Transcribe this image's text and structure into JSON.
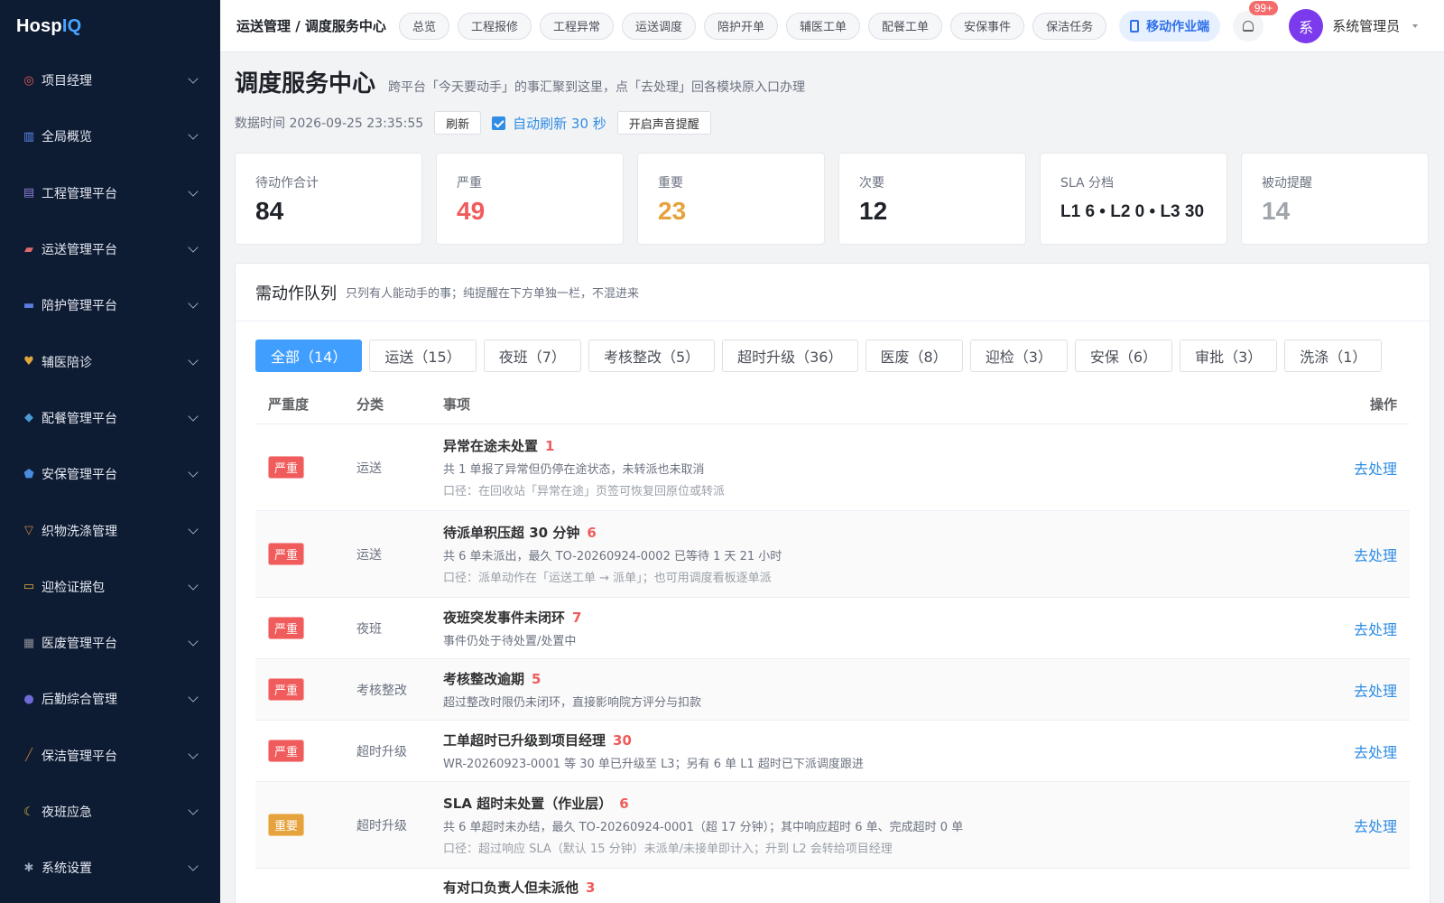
{
  "logo": {
    "part1": "Hosp",
    "part2": "IQ"
  },
  "sidebar": {
    "items": [
      {
        "label": "项目经理",
        "icon": "target-icon",
        "color": "#e85d5d"
      },
      {
        "label": "全局概览",
        "icon": "chart-icon",
        "color": "#5b8def"
      },
      {
        "label": "工程管理平台",
        "icon": "building-icon",
        "color": "#8a7fd6"
      },
      {
        "label": "运送管理平台",
        "icon": "truck-icon",
        "color": "#e06b6b"
      },
      {
        "label": "陪护管理平台",
        "icon": "bed-icon",
        "color": "#5a7de0"
      },
      {
        "label": "辅医陪诊",
        "icon": "heart-icon",
        "color": "#e0a83a"
      },
      {
        "label": "配餐管理平台",
        "icon": "meal-icon",
        "color": "#4a9bd4"
      },
      {
        "label": "安保管理平台",
        "icon": "shield-icon",
        "color": "#4a8ce0"
      },
      {
        "label": "织物洗涤管理",
        "icon": "basket-icon",
        "color": "#c98a3a"
      },
      {
        "label": "迎检证据包",
        "icon": "folder-icon",
        "color": "#e8b23a"
      },
      {
        "label": "医废管理平台",
        "icon": "trash-icon",
        "color": "#8d8f96"
      },
      {
        "label": "后勤综合管理",
        "icon": "people-icon",
        "color": "#6f6ad6"
      },
      {
        "label": "保洁管理平台",
        "icon": "broom-icon",
        "color": "#b0743a"
      },
      {
        "label": "夜班应急",
        "icon": "moon-icon",
        "color": "#e8c43a"
      },
      {
        "label": "系统设置",
        "icon": "gear-icon",
        "color": "#9aa6bb"
      }
    ]
  },
  "header": {
    "breadcrumb": "运送管理 / 调度服务中心",
    "tabs": [
      "总览",
      "工程报修",
      "工程异常",
      "运送调度",
      "陪护开单",
      "辅医工单",
      "配餐工单",
      "安保事件",
      "保洁任务"
    ],
    "mobile_label": "移动作业端",
    "notif_count": "99+",
    "avatar_text": "系",
    "username": "系统管理员"
  },
  "page": {
    "title": "调度服务中心",
    "subtitle": "跨平台「今天要动手」的事汇聚到这里，点「去处理」回各模块原入口办理",
    "data_time": "数据时间 2026-09-25 23:35:55",
    "refresh_label": "刷新",
    "auto_refresh_label": "自动刷新 30 秒",
    "sound_label": "开启声音提醒"
  },
  "stats": [
    {
      "label": "待动作合计",
      "value": "84",
      "color": "#1f2329"
    },
    {
      "label": "严重",
      "value": "49",
      "color": "#f05b5b"
    },
    {
      "label": "重要",
      "value": "23",
      "color": "#e6a23c"
    },
    {
      "label": "次要",
      "value": "12",
      "color": "#1f2329"
    },
    {
      "label": "SLA 分档",
      "value": "L1 6 • L2 0 • L3 30",
      "color": "#1f2329"
    },
    {
      "label": "被动提醒",
      "value": "14",
      "color": "#a0a4ab"
    }
  ],
  "queue": {
    "title": "需动作队列",
    "subtitle": "只列有人能动手的事；纯提醒在下方单独一栏，不混进来",
    "filters": [
      "全部（14）",
      "运送（15）",
      "夜班（7）",
      "考核整改（5）",
      "超时升级（36）",
      "医废（8）",
      "迎检（3）",
      "安保（6）",
      "审批（3）",
      "洗涤（1）"
    ],
    "columns": {
      "severity": "严重度",
      "category": "分类",
      "item": "事项",
      "op": "操作"
    },
    "rows": [
      {
        "severity": "严重",
        "sev_color": "red",
        "category": "运送",
        "title": "异常在途未处置",
        "count": "1",
        "desc": "共 1 单报了异常但仍停在途状态，未转派也未取消",
        "note": "口径：在回收站「异常在途」页签可恢复回原位或转派",
        "op": "去处理"
      },
      {
        "severity": "严重",
        "sev_color": "red",
        "category": "运送",
        "title": "待派单积压超 30 分钟",
        "count": "6",
        "desc": "共 6 单未派出，最久 TO-20260924-0002 已等待 1 天 21 小时",
        "note": "口径：派单动作在「运送工单 → 派单」；也可用调度看板逐单派",
        "op": "去处理"
      },
      {
        "severity": "严重",
        "sev_color": "red",
        "category": "夜班",
        "title": "夜班突发事件未闭环",
        "count": "7",
        "desc": "事件仍处于待处置/处置中",
        "note": "",
        "op": "去处理"
      },
      {
        "severity": "严重",
        "sev_color": "red",
        "category": "考核整改",
        "title": "考核整改逾期",
        "count": "5",
        "desc": "超过整改时限仍未闭环，直接影响院方评分与扣款",
        "note": "",
        "op": "去处理"
      },
      {
        "severity": "严重",
        "sev_color": "red",
        "category": "超时升级",
        "title": "工单超时已升级到项目经理",
        "count": "30",
        "desc": "WR-20260923-0001 等 30 单已升级至 L3；另有 6 单 L1 超时已下派调度跟进",
        "note": "",
        "op": "去处理"
      },
      {
        "severity": "重要",
        "sev_color": "orange",
        "category": "超时升级",
        "title": "SLA 超时未处置（作业层）",
        "count": "6",
        "desc": "共 6 单超时未办结，最久 TO-20260924-0001（超 17 分钟）；其中响应超时 6 单、完成超时 0 单",
        "note": "口径：超过响应 SLA（默认 15 分钟）未派单/未接单即计入；升到 L2 会转给项目经理",
        "op": "去处理"
      },
      {
        "severity": "",
        "sev_color": "none",
        "category": "",
        "title": "有对口负责人但未派他",
        "count": "3",
        "desc": "",
        "note": "",
        "op": ""
      }
    ]
  }
}
